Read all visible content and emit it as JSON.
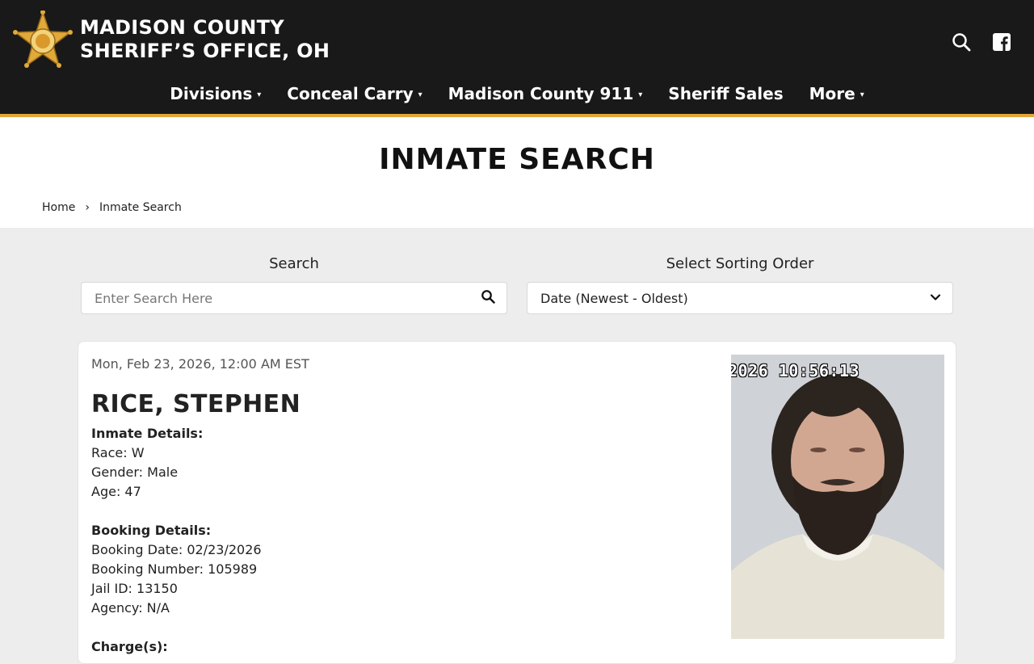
{
  "header": {
    "brand_line1": "MADISON COUNTY",
    "brand_line2": "SHERIFF’S OFFICE, OH",
    "logo_icon": "sheriff-star-badge",
    "icons": [
      "search-icon",
      "facebook-icon"
    ],
    "colors": {
      "bar": "#191919",
      "accent": "#e3a53a",
      "badge_gold": "#e1a93a"
    }
  },
  "nav": {
    "items": [
      {
        "label": "Divisions",
        "has_dropdown": true
      },
      {
        "label": "Conceal Carry",
        "has_dropdown": true
      },
      {
        "label": "Madison County 911",
        "has_dropdown": true
      },
      {
        "label": "Sheriff Sales",
        "has_dropdown": false
      },
      {
        "label": "More",
        "has_dropdown": true
      }
    ],
    "caret": "▾"
  },
  "page": {
    "title": "INMATE SEARCH",
    "breadcrumb": {
      "home": "Home",
      "separator": "›",
      "current": "Inmate Search"
    }
  },
  "filters": {
    "search_label": "Search",
    "search_placeholder": "Enter Search Here",
    "sort_label": "Select Sorting Order",
    "sort_value": "Date (Newest - Oldest)"
  },
  "inmate": {
    "date": "Mon, Feb 23, 2026, 12:00 AM EST",
    "name": "RICE, STEPHEN",
    "inmate_details_heading": "Inmate Details:",
    "race": "Race: W",
    "gender": "Gender: Male",
    "age": "Age: 47",
    "booking_details_heading": "Booking Details:",
    "booking_date": "Booking Date: 02/23/2026",
    "booking_number": "Booking Number: 105989",
    "jail_id": "Jail ID: 13150",
    "agency": "Agency: N/A",
    "charges_heading": "Charge(s):",
    "photo_timestamp": "2026 10:56:13"
  }
}
